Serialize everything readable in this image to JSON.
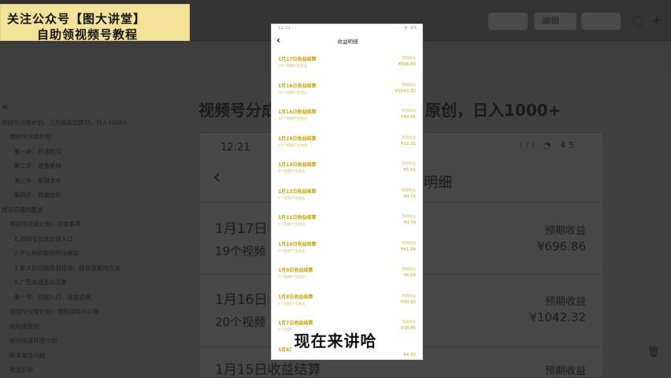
{
  "banner": {
    "line1": "关注公众号【",
    "bracket_text": "图大讲堂",
    "line1_end": "】",
    "line2": "自助领视频号教程"
  },
  "background": {
    "topbar": {
      "edit_label": "编辑"
    },
    "doc_title_left": "视频号分成",
    "doc_title_right": "原创，日入1000+",
    "toc": [
      "视频号分成计划，三天搞定过原创，日入1000+",
      "·视频号分成计划",
      "第一步：开通账号",
      "第二步：准备素材",
      "第三步：剪辑发布",
      "第四步：数据分析",
      "成功开通的要求",
      "·视频号分成计划，注意事项",
      "1.视频号分成计划入口",
      "2.什么样的视频可以参加",
      "3.新人如何做原创视频，获得流量的方法",
      "4.广告收益怎么计算",
      "第一节：视频入口，收益说明",
      "·视频号分成计划，规则说明与心得",
      "·如何做原创",
      "·如何快速开通计划",
      "·新手常见问题",
      "·收益分析"
    ],
    "shot": {
      "time": "12:21",
      "status": "⁝⁝⁝ ◔ 45",
      "tail": "明细",
      "rows": [
        {
          "title": "1月17日",
          "sub": "19个视频",
          "label": "预期收益",
          "amount": "¥696.86"
        },
        {
          "title": "1月16日",
          "sub": "20个视频",
          "label": "预期收益",
          "amount": "¥1042.32"
        },
        {
          "title": "1月15日收益结算",
          "sub": "",
          "label": "预期收益",
          "amount": ""
        }
      ]
    }
  },
  "phone": {
    "status_time": "12:21",
    "status_icons": "··· ◔ 45",
    "back_label": "‹",
    "title": "收益明细",
    "rows": [
      {
        "title": "1月17日收益结算",
        "sub": "19个视频产生收益",
        "label": "预期收益",
        "amount": "¥696.86"
      },
      {
        "title": "1月16日收益结算",
        "sub": "20个视频产生收益",
        "label": "预期收益",
        "amount": "¥1042.32"
      },
      {
        "title": "1月15日收益结算",
        "sub": "18个视频产生收益",
        "label": "预期收益",
        "amount": "¥48.65"
      },
      {
        "title": "1月14日收益结算",
        "sub": "13个视频产生收益",
        "label": "预期收益",
        "amount": "¥12.31"
      },
      {
        "title": "1月13日收益结算",
        "sub": "9个视频产生收益",
        "label": "预期收益",
        "amount": "¥5.51"
      },
      {
        "title": "1月12日收益结算",
        "sub": "6个视频产生收益",
        "label": "预期收益",
        "amount": "¥0.72"
      },
      {
        "title": "1月11日收益结算",
        "sub": "5个视频产生收益",
        "label": "预期收益",
        "amount": "¥0.79"
      },
      {
        "title": "1月10日收益结算",
        "sub": "9个视频产生收益",
        "label": "预期收益",
        "amount": "¥41.84"
      },
      {
        "title": "1月9日收益结算",
        "sub": "6个视频产生收益",
        "label": "预期收益",
        "amount": "¥6.64"
      },
      {
        "title": "1月8日收益结算",
        "sub": "6个视频产生收益",
        "label": "预期收益",
        "amount": "¥30.92"
      },
      {
        "title": "1月7日收益结算",
        "sub": "6个视频产生收益",
        "label": "预期收益",
        "amount": "¥38.85"
      },
      {
        "title": "1月6日收益结算",
        "sub": "",
        "label": "",
        "amount": "¥4.43"
      }
    ]
  },
  "caption": "现在来讲哈"
}
